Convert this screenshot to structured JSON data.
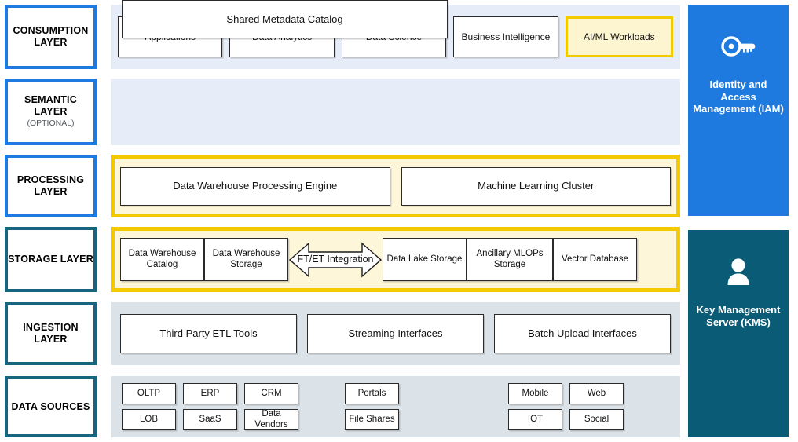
{
  "layers": [
    {
      "id": "consumption",
      "title": "CONSUMPTION LAYER",
      "subtitle": "",
      "border_color": "#1f7ae0",
      "band_bg": "#e7edf8",
      "nodes": [
        {
          "label": "Applications",
          "highlight": false
        },
        {
          "label": "Data Analytics",
          "highlight": false
        },
        {
          "label": "Data Science",
          "highlight": false
        },
        {
          "label": "Business Intelligence",
          "highlight": false
        },
        {
          "label": "AI/ML Workloads",
          "highlight": true
        }
      ]
    },
    {
      "id": "semantic",
      "title": "SEMANTIC LAYER",
      "subtitle": "(OPTIONAL)",
      "border_color": "#1f7ae0",
      "band_bg": "#e7edf8",
      "nodes": [
        {
          "label": "Shared Metadata Catalog",
          "highlight": false
        }
      ]
    },
    {
      "id": "processing",
      "title": "PROCESSING LAYER",
      "subtitle": "",
      "border_color": "#1f7ae0",
      "band_bg": "#fdf6d8",
      "band_border": "#f3ca00",
      "nodes": [
        {
          "label": "Data Warehouse Processing Engine",
          "highlight": false
        },
        {
          "label": "Machine Learning Cluster",
          "highlight": false
        }
      ]
    },
    {
      "id": "storage",
      "title": "STORAGE LAYER",
      "subtitle": "",
      "border_color": "#19647e",
      "band_bg": "#fdf6d8",
      "band_border": "#f3ca00",
      "nodes": [
        {
          "label": "Data Warehouse Catalog",
          "highlight": false
        },
        {
          "label": "Data Warehouse Storage",
          "highlight": false
        },
        {
          "label": "FT/ET Integration",
          "highlight": false,
          "shape": "double-arrow"
        },
        {
          "label": "Data Lake Storage",
          "highlight": false
        },
        {
          "label": "Ancillary MLOPs Storage",
          "highlight": false
        },
        {
          "label": "Vector Database",
          "highlight": false
        }
      ]
    },
    {
      "id": "ingestion",
      "title": "INGESTION LAYER",
      "subtitle": "",
      "border_color": "#19647e",
      "band_bg": "#dce3e8",
      "nodes": [
        {
          "label": "Third Party ETL Tools",
          "highlight": false
        },
        {
          "label": "Streaming Interfaces",
          "highlight": false
        },
        {
          "label": "Batch Upload Interfaces",
          "highlight": false
        }
      ]
    },
    {
      "id": "sources",
      "title": "DATA SOURCES",
      "subtitle": "",
      "border_color": "#19647e",
      "band_bg": "#dce3e8",
      "groups": [
        {
          "items": [
            "OLTP",
            "ERP",
            "CRM",
            "LOB",
            "SaaS",
            "Data Vendors"
          ]
        },
        {
          "items": [
            "Portals",
            "File Shares"
          ]
        },
        {
          "items": [
            "Mobile",
            "Web",
            "IOT",
            "Social"
          ]
        }
      ]
    }
  ],
  "side_panels": [
    {
      "id": "iam",
      "title": "Identity and Access Management (IAM)",
      "icon": "key-icon",
      "color": "#1f7ae0"
    },
    {
      "id": "kms",
      "title": "Key Management Server (KMS)",
      "icon": "user-icon",
      "color": "#0a5b75"
    }
  ],
  "colors": {
    "accent_blue": "#1f7ae0",
    "accent_teal": "#19647e",
    "accent_yellow": "#f3ca00",
    "band_blue": "#e7edf8",
    "band_gray": "#dce3e8",
    "band_yellow": "#fdf6d8",
    "highlight_fill": "#fdf5cf"
  }
}
